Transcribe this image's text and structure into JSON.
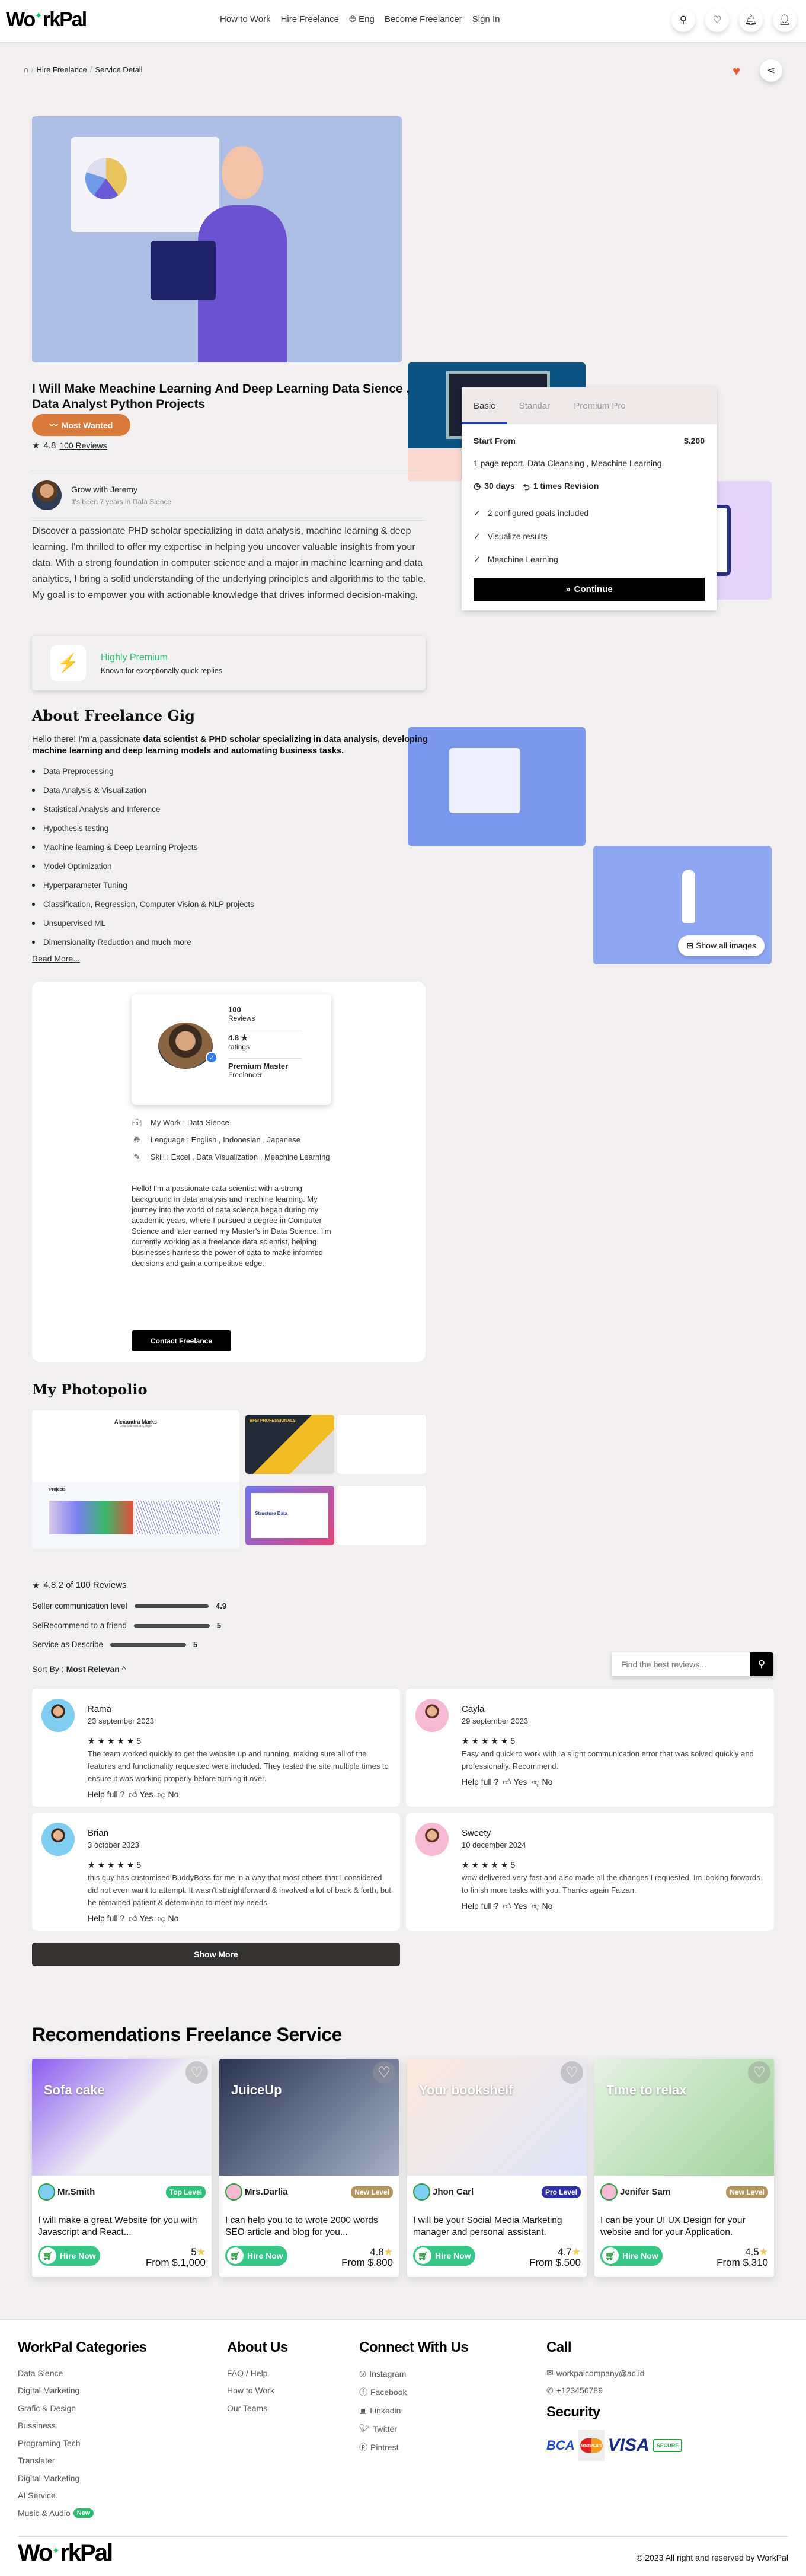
{
  "header": {
    "logo_left": "Wo",
    "logo_right": "rkPal",
    "logo_text": "WorkPal",
    "nav": [
      "How to Work",
      "Hire Freelance",
      "Eng",
      "Become Freelancer",
      "Sign In"
    ]
  },
  "breadcrumb": [
    "Hire Freelance",
    "Service Detail"
  ],
  "gallery": {
    "show_all": "Show all images"
  },
  "gig": {
    "title": "I Will Make Meachine Learning And Deep Learning Data Sience , Data Analyst Python Projects",
    "badge": "Most Wanted",
    "rating": "4.8",
    "reviews_link": "100 Reviews",
    "author": {
      "name": "Grow with Jeremy",
      "subtitle": "It's been 7 years in Data Sience"
    },
    "description": "Discover a passionate PHD scholar specializing in data analysis, machine learning & deep learning. I'm thrilled to offer my expertise in helping you uncover valuable insights from your data. With a strong foundation in computer science and a major in machine learning and data analytics, I bring a solid understanding of the underlying principles and algorithms to the table. My goal is to empower you with actionable knowledge that drives informed decision-making.",
    "premium": {
      "title": "Highly Premium",
      "subtitle": "Known for exceptionally quick replies"
    }
  },
  "package": {
    "tabs": [
      "Basic",
      "Standar",
      "Premium Pro"
    ],
    "active_tab": "Basic",
    "start_from": "Start From",
    "price": "$.200",
    "summary": "1 page report, Data Cleansing , Meachine Learning",
    "days": "30 days",
    "revisions": "1 times Revision",
    "features": [
      "2 configured goals included",
      "Visualize results",
      "Meachine Learning"
    ],
    "continue": "Continue"
  },
  "about": {
    "heading": "About Freelance Gig",
    "intro_plain": "Hello there! I'm a passionate ",
    "intro_bold": "data scientist & PHD scholar specializing in data analysis, developing machine learning and deep learning models and automating business tasks.",
    "items": [
      "Data Preprocessing",
      "Data Analysis & Visualization",
      "Statistical Analysis and Inference",
      "Hypothesis testing",
      "Machine learning & Deep Learning Projects",
      "Model Optimization",
      "Hyperparameter Tuning",
      "Classification, Regression, Computer Vision & NLP projects",
      "Unsupervised ML",
      "Dimensionality Reduction and much more"
    ],
    "read_more": "Read More..."
  },
  "profile": {
    "reviews_count": "100",
    "reviews_label": "Reviews",
    "rating": "4.8 ★",
    "rating_label": "ratings",
    "level": "Premium Master",
    "role": "Freelancer",
    "work": "My Work : Data Sience",
    "language": "Lenguage : English , Indonesian , Japanese",
    "skill": "Skill : Excel , Data Visualization , Meachine Learning",
    "bio": "Hello! I'm a passionate data scientist with a strong background in data analysis and machine learning. My journey into the world of data science began during my academic years, where I pursued a degree in Computer Science and later earned my Master's in Data Science. I'm currently working as a freelance data scientist, helping businesses harness the power of data to make informed decisions and gain a competitive edge.",
    "contact": "Contact Freelance"
  },
  "portfolio": {
    "heading": "My Photopolio",
    "main_name": "Alexandra Marks",
    "main_sub": "Data Scientist at Google",
    "projects_label": "Projects",
    "banner_text": "BFSI PROFESSIONALS",
    "structure_text": "Structure Data"
  },
  "reviews_summary": {
    "headline": "4.8.2 of 100 Reviews",
    "metrics": [
      {
        "label": "Seller communication level",
        "value": "4.9",
        "score": 4.9
      },
      {
        "label": "SelRecommend to a friend",
        "value": "5",
        "score": 5
      },
      {
        "label": "Service as Describe",
        "value": "5",
        "score": 5
      }
    ],
    "sort_label": "Sort By : ",
    "sort_value": "Most Relevan",
    "search_placeholder": "Find the best reviews..."
  },
  "reviews": [
    {
      "name": "Rama",
      "date": "23 september 2023",
      "rating": "5",
      "text": "The team worked quickly to get the website up and running, making sure all of the features and functionality requested were included. They tested the site multiple times to ensure it was working properly before turning it over."
    },
    {
      "name": "Cayla",
      "date": "29 september 2023",
      "rating": "5",
      "text": "Easy and quick to work with, a slight communication error that was solved quickly and professionally. Recommend."
    },
    {
      "name": "Brian",
      "date": "3 october 2023",
      "rating": "5",
      "text": "this guy has customised BuddyBoss for me in a way that most others that I considered did not even want to attempt. It wasn't straightforward & involved a lot of back & forth, but he remained patient & determined to meet my needs."
    },
    {
      "name": "Sweety",
      "date": "10 december 2024",
      "rating": "5",
      "text": "wow delivered very fast and also made all the changes I requested. Im looking forwards to finish more tasks with you. Thanks again Faizan."
    }
  ],
  "review_ui": {
    "helpful": "Help full ?",
    "yes": "Yes",
    "no": "No"
  },
  "show_more": "Show More",
  "recommendations": {
    "heading": "Recomendations Freelance Service",
    "hire": "Hire Now",
    "cards": [
      {
        "name": "Mr.Smith",
        "level": "Top Level",
        "level_color": "#2fc27a",
        "title": "I will make a great Website for you with Javascript and React...",
        "rating": "5",
        "price": "From $.1,000",
        "img_text": "Sofa cake"
      },
      {
        "name": "Mrs.Darlia",
        "level": "New Level",
        "level_color": "#b39560",
        "title": "I can help you to to wrote 2000 words SEO article and blog for you...",
        "rating": "4.8",
        "price": "From $.800",
        "img_text": "JuiceUp"
      },
      {
        "name": "Jhon Carl",
        "level": "Pro Level",
        "level_color": "#2f2fa8",
        "title": "I will be your Social Media Marketing manager and personal assistant.",
        "rating": "4.7",
        "price": "From $.500",
        "img_text": "Your bookshelf"
      },
      {
        "name": "Jenifer Sam",
        "level": "New Level",
        "level_color": "#b39560",
        "title": "I can be your UI UX Design for your website and for your Application.",
        "rating": "4.5",
        "price": "From $.310",
        "img_text": "Time to relax"
      }
    ]
  },
  "footer": {
    "categories": {
      "heading": "WorkPal Categories",
      "items": [
        "Data Sience",
        "Digital Marketing",
        "Grafic & Design",
        "Bussiness",
        "Programing Tech",
        "Translater",
        "Digital Marketing",
        "AI Service",
        "Music & Audio"
      ],
      "new_badge": "New"
    },
    "about": {
      "heading": "About Us",
      "items": [
        "FAQ / Help",
        "How to Work",
        "Our Teams"
      ]
    },
    "connect": {
      "heading": "Connect With Us",
      "items": [
        "Instagram",
        "Facebook",
        "Linkedin",
        "Twitter",
        "Pintrest"
      ]
    },
    "call": {
      "heading": "Call",
      "email": "workpalcompany@ac.id",
      "phone": "+123456789"
    },
    "security": {
      "heading": "Security",
      "logos": [
        "BCA",
        "MasterCard",
        "VISA",
        "SECURE"
      ]
    },
    "copyright": "© 2023 All right and reserved by WorkPal"
  }
}
